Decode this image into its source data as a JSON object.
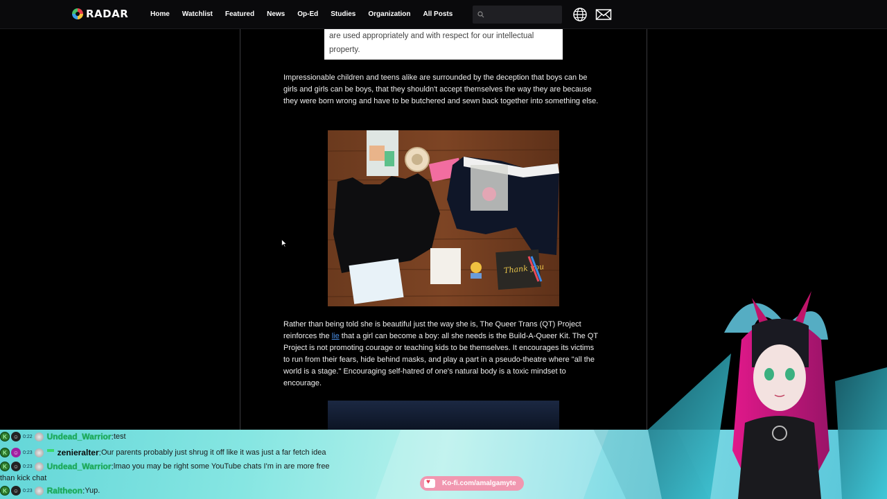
{
  "nav": {
    "logo_text": "RADAR",
    "links": [
      "Home",
      "Watchlist",
      "Featured",
      "News",
      "Op-Ed",
      "Studies",
      "Organization",
      "All Posts"
    ],
    "search_placeholder": "",
    "globe_icon": "globe-icon",
    "mail_icon": "mail-icon"
  },
  "article": {
    "quote_box_text": "are used appropriately and with respect for our intellectual property.",
    "para1": "Impressionable children and teens alike are surrounded by the deception that boys can be girls and girls can be boys, that they shouldn't accept themselves the way they are because they were born wrong and have to be butchered and sewn back together into something else.",
    "para2_before": "Rather than being told she is beautiful just the way she is, The Queer Trans (QT) Project reinforces the ",
    "para2_link": "lie",
    "para2_after": " that a girl can become a boy: all she needs is the Build-A-Queer Kit. The QT Project is not promoting courage or teaching kids to be themselves. It encourages its victims to run from their fears, hide behind masks, and play a part in a pseudo-theatre where \"all the world is a stage.\" Encouraging self-hatred of one's natural body is a toxic mindset to encourage.",
    "photo_caption": "Thank you"
  },
  "chat": [
    {
      "time": "0:22",
      "user": "Undead_Warrior",
      "text": " test",
      "name_style": "green"
    },
    {
      "time": "0:23",
      "user": "zenieralter",
      "text": " Our parents probably just shrug it off like it was just a far fetch idea",
      "name_style": "black"
    },
    {
      "time": "0:23",
      "user": "Undead_Warrior",
      "text": " lmao you may be right some YouTube chats I'm in are more free",
      "text2": "than kick chat",
      "name_style": "green"
    },
    {
      "time": "0:23",
      "user": "Raltheon",
      "text": " Yup.",
      "name_style": "green"
    }
  ],
  "kofi": {
    "label": "Ko-fi.com/amalgamyte"
  },
  "colors": {
    "nav_bg": "#0a0a0c",
    "link": "#4a90e8",
    "overlay": "#86e6e2",
    "kofi": "#f197b0"
  }
}
